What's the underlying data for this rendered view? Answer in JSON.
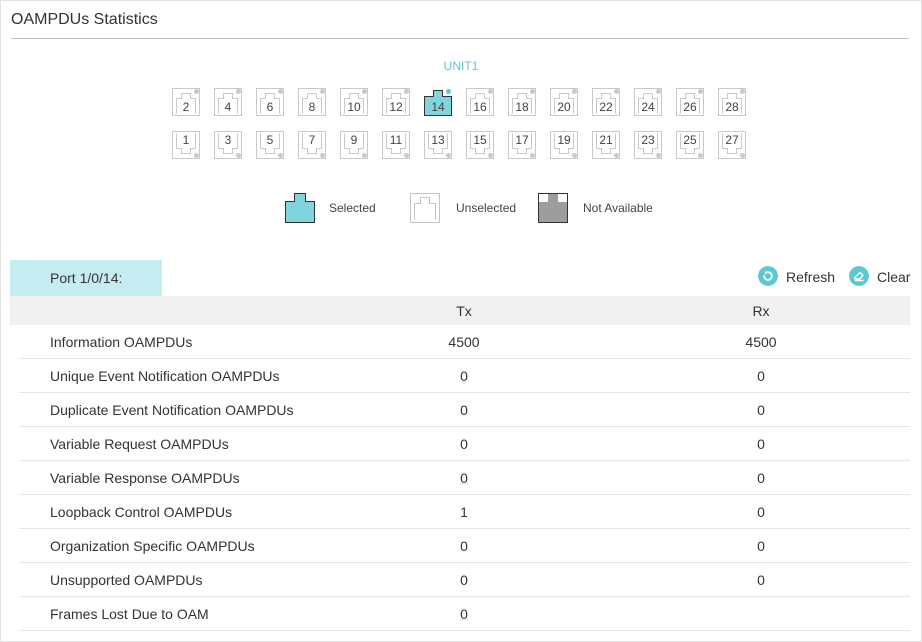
{
  "page": {
    "title": "OAMPDUs Statistics"
  },
  "colors": {
    "accent": "#5bc8d2",
    "selected_fill": "#7fd4de",
    "na_fill": "#9d9d9d",
    "tab_bg": "#c5ecf0"
  },
  "panel": {
    "unit_label": "UNIT1",
    "top_ports": [
      "2",
      "4",
      "6",
      "8",
      "10",
      "12",
      "14",
      "16",
      "18",
      "20",
      "22",
      "24",
      "26",
      "28"
    ],
    "bottom_ports": [
      "1",
      "3",
      "5",
      "7",
      "9",
      "11",
      "13",
      "15",
      "17",
      "19",
      "21",
      "23",
      "25",
      "27"
    ],
    "selected_port": "14"
  },
  "legend": {
    "selected": "Selected",
    "unselected": "Unselected",
    "not_available": "Not Available"
  },
  "port_tab": {
    "label": "Port 1/0/14:"
  },
  "actions": {
    "refresh": {
      "label": "Refresh",
      "icon": "refresh-icon"
    },
    "clear": {
      "label": "Clear",
      "icon": "eraser-icon"
    }
  },
  "table": {
    "columns": [
      "",
      "Tx",
      "Rx"
    ],
    "rows": [
      {
        "name": "Information OAMPDUs",
        "tx": "4500",
        "rx": "4500"
      },
      {
        "name": "Unique Event Notification OAMPDUs",
        "tx": "0",
        "rx": "0"
      },
      {
        "name": "Duplicate Event Notification OAMPDUs",
        "tx": "0",
        "rx": "0"
      },
      {
        "name": "Variable Request OAMPDUs",
        "tx": "0",
        "rx": "0"
      },
      {
        "name": "Variable Response OAMPDUs",
        "tx": "0",
        "rx": "0"
      },
      {
        "name": "Loopback Control OAMPDUs",
        "tx": "1",
        "rx": "0"
      },
      {
        "name": "Organization Specific OAMPDUs",
        "tx": "0",
        "rx": "0"
      },
      {
        "name": "Unsupported OAMPDUs",
        "tx": "0",
        "rx": "0"
      },
      {
        "name": "Frames Lost Due to OAM",
        "tx": "0",
        "rx": ""
      }
    ]
  }
}
